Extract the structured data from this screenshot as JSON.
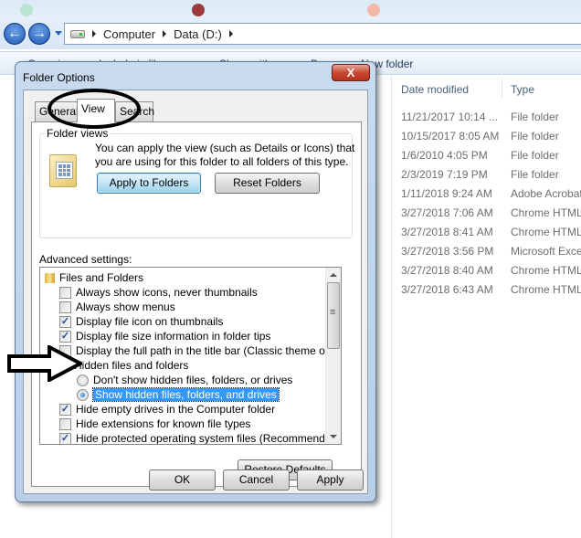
{
  "explorer": {
    "breadcrumb": [
      "Computer",
      "Data (D:)"
    ],
    "toolbar": [
      "Organize ▾",
      "Include in library ▾",
      "Share with ▾",
      "Burn",
      "New folder"
    ],
    "columns": {
      "date": "Date modified",
      "type": "Type"
    },
    "files": [
      {
        "date": "11/21/2017 10:14 ...",
        "type": "File folder"
      },
      {
        "date": "10/15/2017 8:05 AM",
        "type": "File folder"
      },
      {
        "date": "1/6/2010 4:05 PM",
        "type": "File folder"
      },
      {
        "date": "2/3/2019 7:19 PM",
        "type": "File folder"
      },
      {
        "date": "1/11/2018 9:24 AM",
        "type": "Adobe Acrobat"
      },
      {
        "date": "3/27/2018 7:06 AM",
        "type": "Chrome HTML"
      },
      {
        "date": "3/27/2018 8:41 AM",
        "type": "Chrome HTML"
      },
      {
        "date": "3/27/2018 3:56 PM",
        "type": "Microsoft Excel"
      },
      {
        "date": "3/27/2018 8:40 AM",
        "type": "Chrome HTML"
      },
      {
        "date": "3/27/2018 6:43 AM",
        "type": "Chrome HTML"
      }
    ]
  },
  "dialog": {
    "title": "Folder Options",
    "close_glyph": "X",
    "tabs": [
      "General",
      "View",
      "Search"
    ],
    "active_tab": "View",
    "folder_views": {
      "label": "Folder views",
      "description": "You can apply the view (such as Details or Icons) that you are using for this folder to all folders of this type.",
      "apply_button": "Apply to Folders",
      "reset_button": "Reset Folders"
    },
    "advanced_label": "Advanced settings:",
    "settings": [
      {
        "kind": "folder",
        "label": "Files and Folders"
      },
      {
        "kind": "checkbox",
        "label": "Always show icons, never thumbnails",
        "checked": false
      },
      {
        "kind": "checkbox",
        "label": "Always show menus",
        "checked": false
      },
      {
        "kind": "checkbox",
        "label": "Display file icon on thumbnails",
        "checked": true
      },
      {
        "kind": "checkbox",
        "label": "Display file size information in folder tips",
        "checked": true
      },
      {
        "kind": "checkbox",
        "label": "Display the full path in the title bar (Classic theme only)",
        "checked": false
      },
      {
        "kind": "folder",
        "label": "Hidden files and folders"
      },
      {
        "kind": "radio",
        "label": "Don't show hidden files, folders, or drives",
        "checked": false
      },
      {
        "kind": "radio",
        "label": "Show hidden files, folders, and drives",
        "checked": true,
        "selected": true
      },
      {
        "kind": "checkbox",
        "label": "Hide empty drives in the Computer folder",
        "checked": true
      },
      {
        "kind": "checkbox",
        "label": "Hide extensions for known file types",
        "checked": false
      },
      {
        "kind": "checkbox",
        "label": "Hide protected operating system files (Recommended)",
        "checked": true
      }
    ],
    "restore_button": "Restore Defaults",
    "ok_button": "OK",
    "cancel_button": "Cancel",
    "apply_button": "Apply"
  }
}
